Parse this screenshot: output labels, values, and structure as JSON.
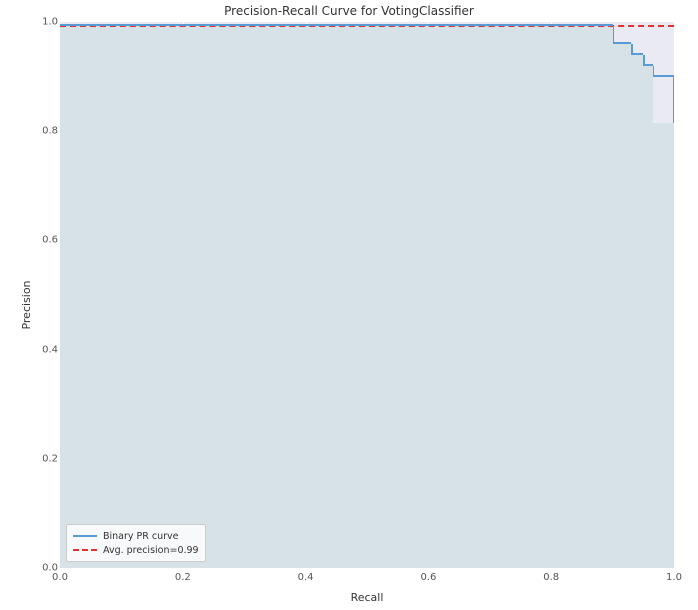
{
  "chart_data": {
    "type": "line",
    "title": "Precision-Recall Curve for VotingClassifier",
    "xlabel": "Recall",
    "ylabel": "Precision",
    "xlim": [
      0.0,
      1.0
    ],
    "ylim": [
      0.0,
      1.0
    ],
    "xticks": [
      0.0,
      0.2,
      0.4,
      0.6,
      0.8,
      1.0
    ],
    "yticks": [
      0.0,
      0.2,
      0.4,
      0.6,
      0.8,
      1.0
    ],
    "avg_precision": 0.99,
    "series": [
      {
        "name": "Binary PR curve",
        "style": "solid",
        "color": "#5b9bd5",
        "x": [
          0.0,
          0.9,
          0.9,
          0.93,
          0.93,
          0.95,
          0.95,
          0.965,
          0.965,
          1.0,
          1.0
        ],
        "y": [
          0.993,
          0.993,
          0.96,
          0.96,
          0.94,
          0.94,
          0.92,
          0.92,
          0.9,
          0.9,
          0.815
        ]
      },
      {
        "name": "Avg. precision=0.99",
        "style": "dashed",
        "color": "#e03030",
        "x": [
          0.0,
          1.0
        ],
        "y": [
          0.99,
          0.99
        ]
      }
    ],
    "legend": {
      "position": "lower left",
      "items": [
        "Binary PR curve",
        "Avg. precision=0.99"
      ]
    }
  }
}
